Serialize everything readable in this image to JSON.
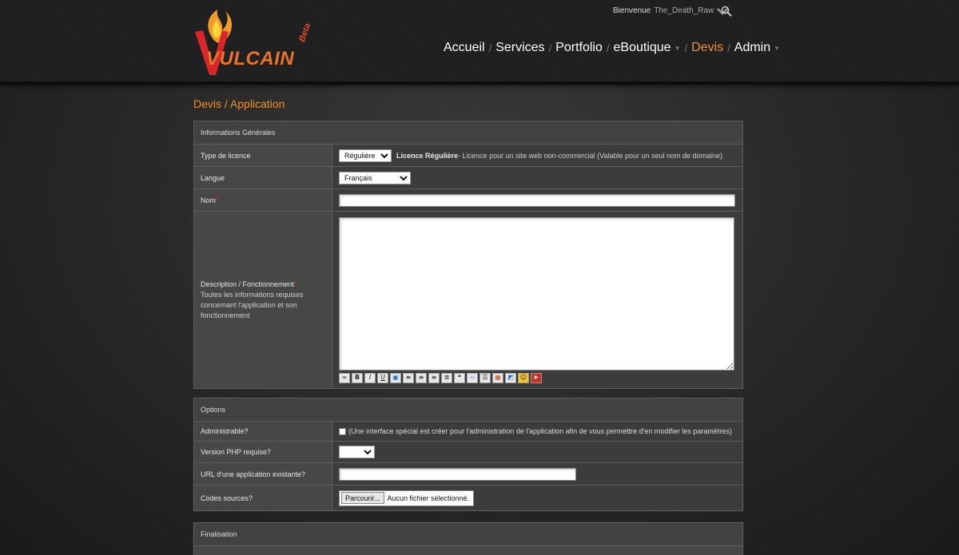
{
  "header": {
    "welcome_label": "Bienvenue",
    "username": "The_Death_Raw",
    "logo_text": "VULCAIN",
    "logo_beta": "Beta",
    "nav": [
      {
        "label": "Accueil"
      },
      {
        "label": "Services"
      },
      {
        "label": "Portfolio"
      },
      {
        "label": "eBoutique"
      },
      {
        "label": "Devis"
      },
      {
        "label": "Admin"
      }
    ]
  },
  "page": {
    "title": "Devis / Application"
  },
  "general": {
    "heading": "Informations Générales",
    "license_label": "Type de licence",
    "license_value": "Régulière",
    "license_bold": "Licence Régulière",
    "license_desc": " - Licence pour un site web non-commercial (Valable pour un seul nom de domaine)",
    "language_label": "Langue",
    "language_value": "Français",
    "name_label": "Nom",
    "name_value": "",
    "desc_label": "Description / Fonctionnement",
    "desc_hint": "Toutes les informations requises concernant l'application et son fonctionnement",
    "desc_value": ""
  },
  "options": {
    "heading": "Options",
    "admin_label": "Administrable?",
    "admin_desc": "(Une interface spécial est créer pour l'administration de l'application afin de vous permettre d'en modifier les paramètres)",
    "php_label": "Version PHP requise?",
    "php_value": "",
    "url_label": "URL d'une application existante?",
    "url_value": "",
    "sources_label": "Codes sources?",
    "file_button": "Parcourir...",
    "file_status": "Aucun fichier sélectionné."
  },
  "final": {
    "heading": "Finalisation"
  },
  "colors": {
    "accent": "#f0912a",
    "required": "#c0392b",
    "logo_red": "#d8262a"
  }
}
